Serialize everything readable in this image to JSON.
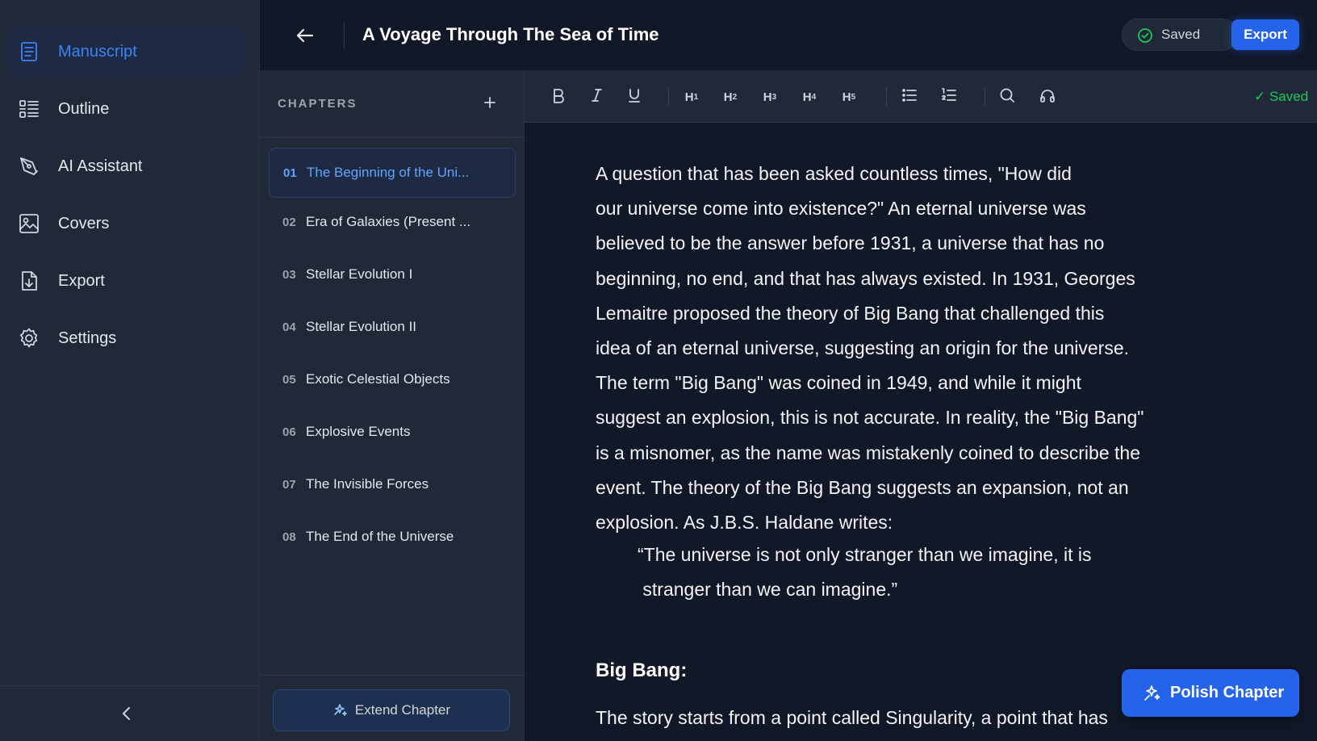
{
  "nav": {
    "items": [
      {
        "label": "Manuscript",
        "icon": "document-icon",
        "active": true
      },
      {
        "label": "Outline",
        "icon": "outline-icon"
      },
      {
        "label": "AI Assistant",
        "icon": "pen-tool-icon"
      },
      {
        "label": "Covers",
        "icon": "image-icon"
      },
      {
        "label": "Export",
        "icon": "file-download-icon"
      },
      {
        "label": "Settings",
        "icon": "gear-icon"
      }
    ]
  },
  "header": {
    "title": "A Voyage Through The Sea of Time",
    "saved_label": "Saved",
    "export_label": "Export"
  },
  "chapters": {
    "heading": "CHAPTERS",
    "items": [
      {
        "num": "01",
        "title": "The Beginning of the Uni...",
        "active": true
      },
      {
        "num": "02",
        "title": "Era of Galaxies (Present ..."
      },
      {
        "num": "03",
        "title": "Stellar Evolution I"
      },
      {
        "num": "04",
        "title": "Stellar Evolution II"
      },
      {
        "num": "05",
        "title": "Exotic Celestial Objects"
      },
      {
        "num": "06",
        "title": "Explosive Events"
      },
      {
        "num": "07",
        "title": "The Invisible Forces"
      },
      {
        "num": "08",
        "title": "The End of the Universe"
      }
    ],
    "extend_label": "Extend Chapter"
  },
  "toolbar": {
    "h1": "H",
    "h2": "H",
    "h3": "H",
    "h4": "H",
    "h5": "H",
    "h1_sub": "1",
    "h2_sub": "2",
    "h3_sub": "3",
    "h4_sub": "4",
    "h5_sub": "5",
    "status": "✓ Saved"
  },
  "editor": {
    "paragraph_lines": [
      "A question that has been asked countless times, \"How did",
      "our universe come into existence?\" An eternal universe was",
      "believed to be the answer before 1931, a universe that has no",
      "beginning, no end, and that has always existed. In 1931, Georges",
      "Lemaitre proposed the theory of Big Bang that challenged this",
      "idea of an eternal universe, suggesting an origin for the universe.",
      "The term \"Big Bang\" was coined in 1949, and while it might",
      "suggest an explosion, this is not accurate. In reality, the \"Big Bang\"",
      "is a misnomer, as the name was mistakenly coined to describe the",
      "event. The theory of the Big Bang suggests an expansion, not an",
      "explosion. As J.B.S. Haldane writes:"
    ],
    "quote_lines": [
      "“The universe is not only stranger than we imagine, it is",
      " stranger than we can imagine.”"
    ],
    "subheading": "Big Bang:",
    "paragraph2": "The story starts from a point called Singularity, a point that has"
  },
  "actions": {
    "polish_label": "Polish Chapter"
  },
  "colors": {
    "accent": "#2563eb",
    "active_text": "#3b82f6",
    "saved_green": "#22c55e",
    "panel_bg": "#1f2937",
    "editor_bg": "#111827"
  }
}
